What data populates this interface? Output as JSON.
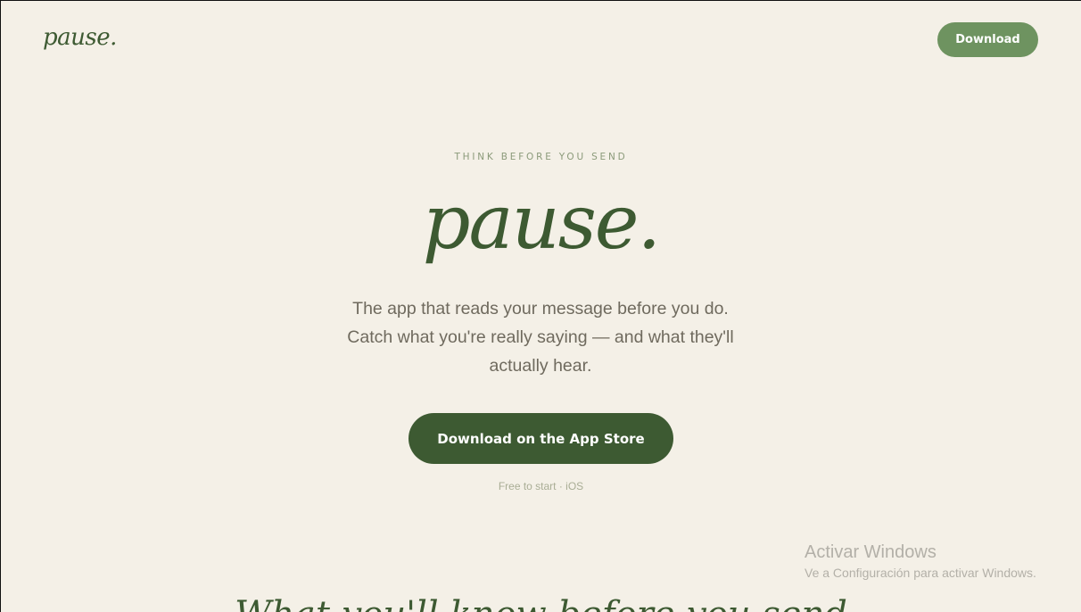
{
  "nav": {
    "logo": "pause.",
    "download_label": "Download"
  },
  "hero": {
    "eyebrow": "THINK BEFORE YOU SEND",
    "title": "pause.",
    "subtitle": "The app that reads your message before you do. Catch what you're really saying — and what they'll actually hear.",
    "cta_label": "Download on the App Store",
    "note": "Free to start · iOS"
  },
  "section": {
    "title": "What you'll know before you send"
  },
  "watermark": {
    "title": "Activar Windows",
    "subtitle": "Ve a Configuración para activar Windows."
  },
  "colors": {
    "background": "#f4f0e7",
    "brand_green": "#3d5a32",
    "light_green": "#6e9360"
  }
}
